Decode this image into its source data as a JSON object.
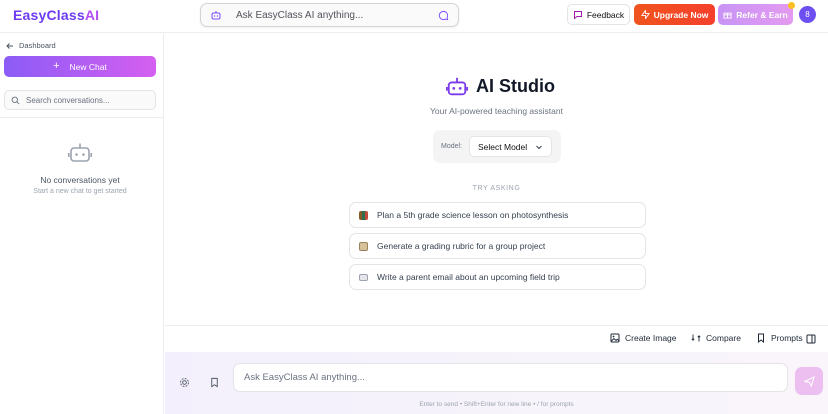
{
  "brand": {
    "part1": "EasyClass",
    "part2": "AI"
  },
  "top_search": {
    "placeholder": "Ask EasyClass AI anything..."
  },
  "top_actions": {
    "feedback": "Feedback",
    "upgrade": "Upgrade Now",
    "refer": "Refer & Earn",
    "avatar_initial": "8"
  },
  "sidebar": {
    "back_label": "Dashboard",
    "new_chat": "New Chat",
    "search_placeholder": "Search conversations...",
    "empty_title": "No conversations yet",
    "empty_subtitle": "Start a new chat to get started"
  },
  "main": {
    "title": "AI Studio",
    "subtitle": "Your AI-powered teaching assistant",
    "model_label": "Model:",
    "model_value": "Select Model",
    "try_label": "TRY ASKING",
    "suggestions": [
      {
        "text": "Plan a 5th grade science lesson on photosynthesis",
        "icon": "books-icon"
      },
      {
        "text": "Generate a grading rubric for a group project",
        "icon": "clipboard-icon"
      },
      {
        "text": "Write a parent email about an upcoming field trip",
        "icon": "envelope-icon"
      }
    ],
    "tools": {
      "create_image": "Create Image",
      "compare": "Compare",
      "prompts": "Prompts"
    },
    "composer_placeholder": "Ask EasyClass AI anything...",
    "hint": "Enter to send • Shift+Enter for new line • / for prompts"
  },
  "colors": {
    "brand_primary": "#6d3cf0",
    "brand_secondary": "#b34cf5",
    "upgrade": "#f0541e",
    "avatar": "#6d4ef0"
  }
}
